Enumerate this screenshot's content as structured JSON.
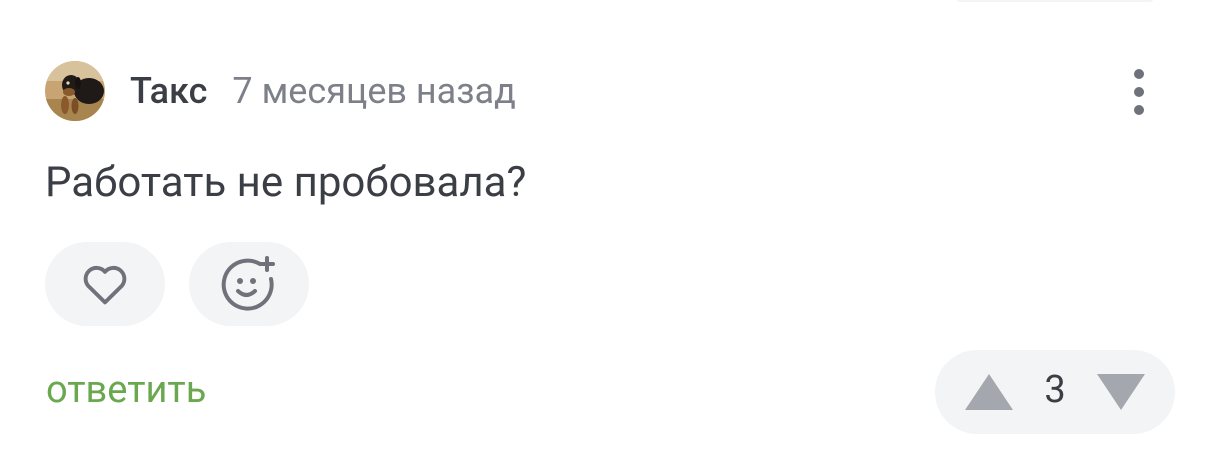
{
  "comment": {
    "author": "Такс",
    "time_ago": "7 месяцев назад",
    "text": "Работать не пробовала?",
    "avatar_icon": "dog-photo-avatar",
    "more_icon": "more-vertical-icon"
  },
  "actions": {
    "like_icon": "heart-icon",
    "reaction_icon": "add-reaction-smiley-icon",
    "reply_label": "ответить"
  },
  "votes": {
    "score": "3",
    "up_icon": "triangle-up-icon",
    "down_icon": "triangle-down-icon"
  },
  "colors": {
    "text": "#3b3e45",
    "muted": "#7d8089",
    "icon": "#6f727a",
    "accent": "#6aa84f",
    "pill_bg": "#f3f4f6",
    "vote_arrow": "#a4a7ad"
  }
}
